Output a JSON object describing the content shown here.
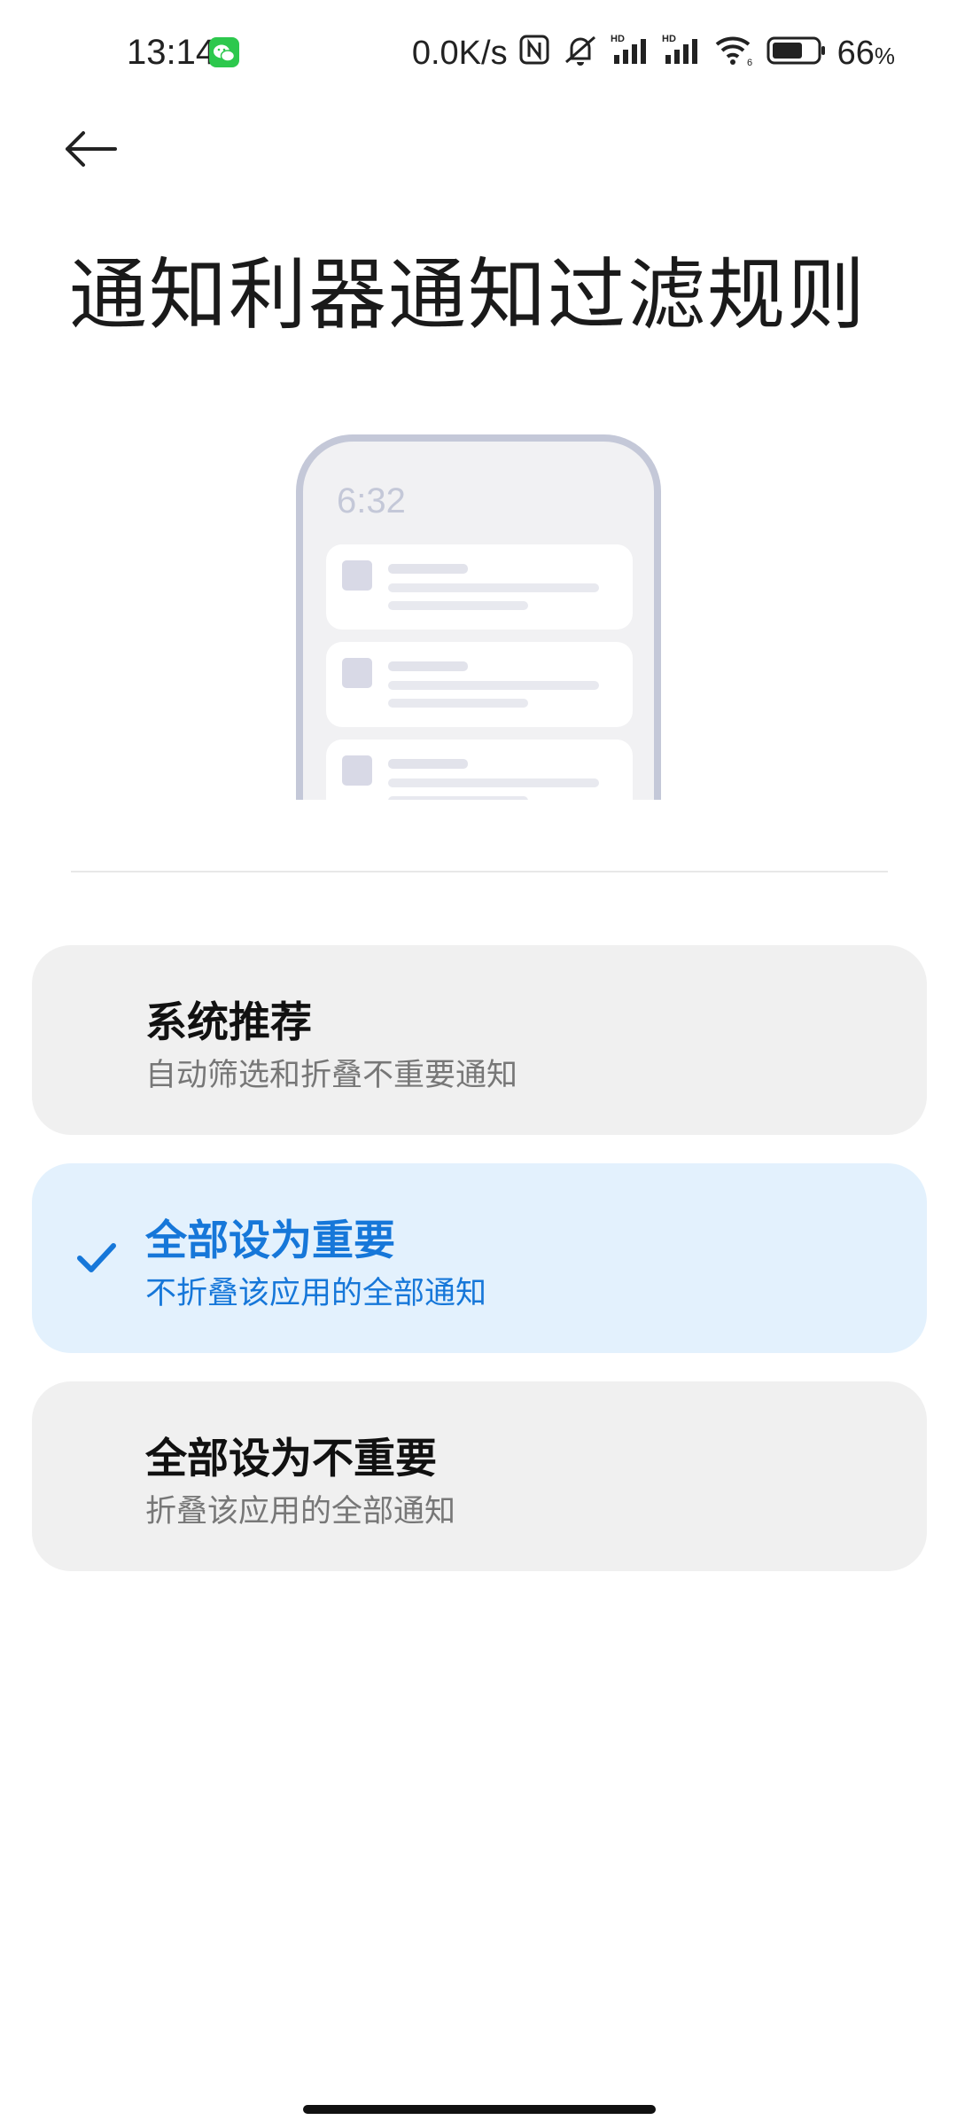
{
  "status_bar": {
    "time": "13:14",
    "network_speed": "0.0K/s",
    "battery_percent": "66",
    "battery_unit": "%",
    "icons": [
      "wechat-icon",
      "nfc-icon",
      "mute-icon",
      "signal-hd-icon",
      "signal-hd-icon",
      "wifi-icon",
      "battery-icon"
    ]
  },
  "header": {
    "title": "通知利器通知过滤规则"
  },
  "illustration": {
    "time": "6:32"
  },
  "options": [
    {
      "title": "系统推荐",
      "subtitle": "自动筛选和折叠不重要通知",
      "selected": false
    },
    {
      "title": "全部设为重要",
      "subtitle": "不折叠该应用的全部通知",
      "selected": true
    },
    {
      "title": "全部设为不重要",
      "subtitle": "折叠该应用的全部通知",
      "selected": false
    }
  ],
  "colors": {
    "accent": "#1677d9",
    "selected_bg": "#e3f1fd",
    "option_bg": "#f0f0f0"
  }
}
